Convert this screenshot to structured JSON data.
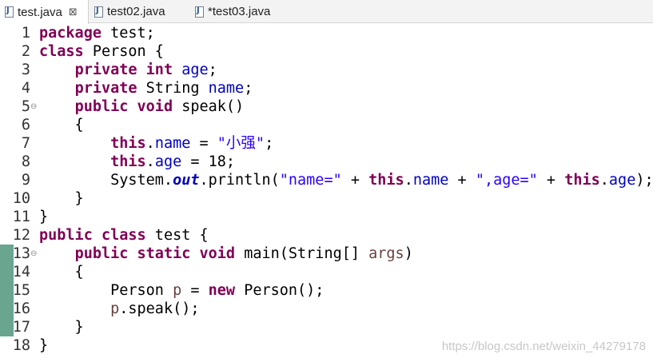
{
  "tabs": [
    {
      "label": "test.java",
      "close": "⊠",
      "active": true
    },
    {
      "label": "test02.java",
      "active": false
    },
    {
      "label": "*test03.java",
      "active": false
    }
  ],
  "colors": {
    "keyword": "#7f0055",
    "field": "#0000c0",
    "string": "#2a00ff",
    "param": "#6a3e3e",
    "change_marker": "#6aa58f"
  },
  "fold_marker": "⊖",
  "code": [
    {
      "n": "1",
      "tokens": [
        {
          "t": "package",
          "c": "kw"
        },
        {
          "t": " test;"
        }
      ]
    },
    {
      "n": "2",
      "tokens": [
        {
          "t": "class",
          "c": "kw"
        },
        {
          "t": " Person {"
        }
      ]
    },
    {
      "n": "3",
      "tokens": [
        {
          "t": "    "
        },
        {
          "t": "private",
          "c": "kw"
        },
        {
          "t": " "
        },
        {
          "t": "int",
          "c": "kw"
        },
        {
          "t": " "
        },
        {
          "t": "age",
          "c": "field"
        },
        {
          "t": ";"
        }
      ]
    },
    {
      "n": "4",
      "tokens": [
        {
          "t": "    "
        },
        {
          "t": "private",
          "c": "kw"
        },
        {
          "t": " String "
        },
        {
          "t": "name",
          "c": "field"
        },
        {
          "t": ";"
        }
      ]
    },
    {
      "n": "5",
      "fold": true,
      "tokens": [
        {
          "t": "    "
        },
        {
          "t": "public",
          "c": "kw"
        },
        {
          "t": " "
        },
        {
          "t": "void",
          "c": "kw"
        },
        {
          "t": " speak()"
        }
      ]
    },
    {
      "n": "6",
      "tokens": [
        {
          "t": "    {"
        }
      ]
    },
    {
      "n": "7",
      "tokens": [
        {
          "t": "        "
        },
        {
          "t": "this",
          "c": "kw"
        },
        {
          "t": "."
        },
        {
          "t": "name",
          "c": "field"
        },
        {
          "t": " = "
        },
        {
          "t": "\"小强\"",
          "c": "str"
        },
        {
          "t": ";"
        }
      ]
    },
    {
      "n": "8",
      "tokens": [
        {
          "t": "        "
        },
        {
          "t": "this",
          "c": "kw"
        },
        {
          "t": "."
        },
        {
          "t": "age",
          "c": "field"
        },
        {
          "t": " = 18;"
        }
      ]
    },
    {
      "n": "9",
      "tokens": [
        {
          "t": "        System."
        },
        {
          "t": "out",
          "c": "static"
        },
        {
          "t": ".println("
        },
        {
          "t": "\"name=\"",
          "c": "str"
        },
        {
          "t": " + "
        },
        {
          "t": "this",
          "c": "kw"
        },
        {
          "t": "."
        },
        {
          "t": "name",
          "c": "field"
        },
        {
          "t": " + "
        },
        {
          "t": "\",age=\"",
          "c": "str"
        },
        {
          "t": " + "
        },
        {
          "t": "this",
          "c": "kw"
        },
        {
          "t": "."
        },
        {
          "t": "age",
          "c": "field"
        },
        {
          "t": ");"
        }
      ]
    },
    {
      "n": "10",
      "tokens": [
        {
          "t": "    }"
        }
      ]
    },
    {
      "n": "11",
      "tokens": [
        {
          "t": "}"
        }
      ]
    },
    {
      "n": "12",
      "tokens": [
        {
          "t": "public",
          "c": "kw"
        },
        {
          "t": " "
        },
        {
          "t": "class",
          "c": "kw"
        },
        {
          "t": " test {"
        }
      ]
    },
    {
      "n": "13",
      "fold": true,
      "changed": true,
      "tokens": [
        {
          "t": "    "
        },
        {
          "t": "public",
          "c": "kw"
        },
        {
          "t": " "
        },
        {
          "t": "static",
          "c": "kw"
        },
        {
          "t": " "
        },
        {
          "t": "void",
          "c": "kw"
        },
        {
          "t": " main(String[] "
        },
        {
          "t": "args",
          "c": "param"
        },
        {
          "t": ")"
        }
      ]
    },
    {
      "n": "14",
      "changed": true,
      "tokens": [
        {
          "t": "    {"
        }
      ]
    },
    {
      "n": "15",
      "changed": true,
      "tokens": [
        {
          "t": "        Person "
        },
        {
          "t": "p",
          "c": "param"
        },
        {
          "t": " = "
        },
        {
          "t": "new",
          "c": "kw"
        },
        {
          "t": " Person();"
        }
      ]
    },
    {
      "n": "16",
      "changed": true,
      "tokens": [
        {
          "t": "        "
        },
        {
          "t": "p",
          "c": "param"
        },
        {
          "t": ".speak();"
        }
      ]
    },
    {
      "n": "17",
      "changed": true,
      "tokens": [
        {
          "t": "    }"
        }
      ]
    },
    {
      "n": "18",
      "tokens": [
        {
          "t": "}"
        }
      ]
    }
  ],
  "watermark": "https://blog.csdn.net/weixin_44279178"
}
